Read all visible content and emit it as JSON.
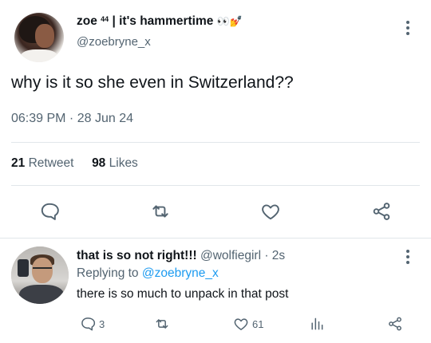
{
  "tweet": {
    "author_name": "zoe",
    "author_sup": "44",
    "author_suffix": "| it's hammertime",
    "author_emoji": "👀💅",
    "handle": "@zoebryne_x",
    "text": "why is it so she even in Switzerland??",
    "timestamp": "06:39 PM · 28 Jun 24",
    "retweet_count": "21",
    "retweet_label": "Retweet",
    "likes_count": "98",
    "likes_label": "Likes"
  },
  "reply": {
    "author_name": "that is so not right!!!",
    "handle_time": "@wolfiegirl · 2s",
    "replying_prefix": "Replying to",
    "replying_to": "@zoebryne_x",
    "text": "there is so much to unpack in that post",
    "reply_count": "3",
    "like_count": "61"
  },
  "icons": {
    "reply": "speech-bubble-icon",
    "retweet": "retweet-arrows-icon",
    "like": "heart-icon",
    "share": "share-icon",
    "stats": "bar-chart-icon",
    "more": "vertical-dots-icon"
  },
  "colors": {
    "text": "#0f1419",
    "secondary": "#536471",
    "link": "#1d9bf0",
    "divider": "#e1e6ea"
  }
}
